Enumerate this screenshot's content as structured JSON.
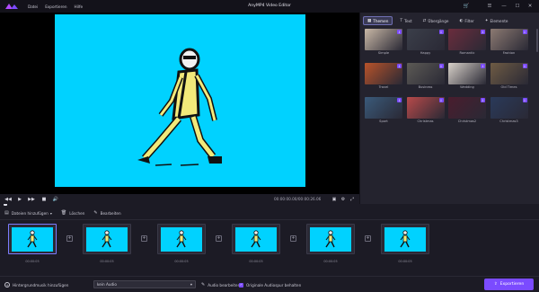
{
  "app": {
    "title": "AnyMP4 Video Editor",
    "menu": [
      "Datei",
      "Exportieren",
      "Hilfe"
    ]
  },
  "colors": {
    "accent": "#7b4bff",
    "video_background": "#00d2ff",
    "panel": "#24232e",
    "app_background": "#1c1b25"
  },
  "player": {
    "timecode": "00:00:00.00/00:00:26.06",
    "controls": [
      "rewind-icon",
      "play-icon",
      "fast-forward-icon",
      "stop-icon",
      "volume-icon"
    ]
  },
  "right_panel": {
    "tabs": [
      {
        "label": "Themen",
        "icon": "themes-icon",
        "active": true
      },
      {
        "label": "Text",
        "icon": "text-icon",
        "active": false
      },
      {
        "label": "Übergänge",
        "icon": "transitions-icon",
        "active": false
      },
      {
        "label": "Filter",
        "icon": "filter-icon",
        "active": false
      },
      {
        "label": "Elemente",
        "icon": "elements-icon",
        "active": false
      }
    ],
    "themes": [
      {
        "label": "Simple",
        "color": "#c9b8a6"
      },
      {
        "label": "Happy",
        "color": "#3b3f4a"
      },
      {
        "label": "Romantic",
        "color": "#6b2d3d"
      },
      {
        "label": "Fashion",
        "color": "#8c7a72"
      },
      {
        "label": "Travel",
        "color": "#b8532a"
      },
      {
        "label": "Business",
        "color": "#5c5a55"
      },
      {
        "label": "Wedding",
        "color": "#d8d1c9"
      },
      {
        "label": "Old Times",
        "color": "#6e5b44"
      },
      {
        "label": "Sport",
        "color": "#3a5a7a"
      },
      {
        "label": "Christmas",
        "color": "#b84a4a"
      },
      {
        "label": "Christmas2",
        "color": "#4a1d2e"
      },
      {
        "label": "Christmas3",
        "color": "#2a3a5a"
      }
    ]
  },
  "toolbar": {
    "add_files": "Dateien hinzufügen",
    "delete": "Löschen",
    "edit": "Bearbeiten"
  },
  "timeline": {
    "clips": [
      {
        "time": "00:00:05",
        "selected": true
      },
      {
        "time": "00:00:05",
        "selected": false
      },
      {
        "time": "00:00:05",
        "selected": false
      },
      {
        "time": "00:00:05",
        "selected": false
      },
      {
        "time": "00:00:05",
        "selected": false
      },
      {
        "time": "00:00:05",
        "selected": false
      }
    ]
  },
  "bottom": {
    "add_music": "Hintergrundmusik hinzufügen",
    "audio_select": "kein Audio",
    "edit_audio": "Audio bearbeiten",
    "keep_original_audio": "Originale Audiospur behalten",
    "keep_original_checked": true,
    "export": "Exportieren"
  }
}
